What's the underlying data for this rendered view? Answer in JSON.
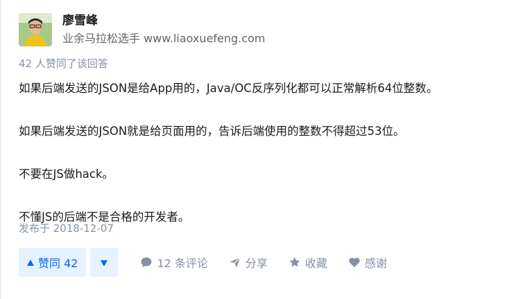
{
  "author": {
    "name": "廖雪峰",
    "headline": "业余马拉松选手 www.liaoxuefeng.com"
  },
  "votes_summary": "42 人赞同了该回答",
  "answer": {
    "paragraphs": [
      "如果后端发送的JSON是给App用的，Java/OC反序列化都可以正常解析64位整数。",
      "如果后端发送的JSON就是给页面用的，告诉后端使用的整数不得超过53位。",
      "不要在JS做hack。",
      "不懂JS的后端不是合格的开发者。"
    ],
    "published": "发布于 2018-12-07"
  },
  "actions": {
    "vote_up": "赞同 42",
    "comments": "12 条评论",
    "share": "分享",
    "collect": "收藏",
    "thanks": "感谢"
  },
  "colors": {
    "accent": "#0066ff",
    "accent_bg": "#e7f2ff",
    "meta": "#8590a6"
  }
}
